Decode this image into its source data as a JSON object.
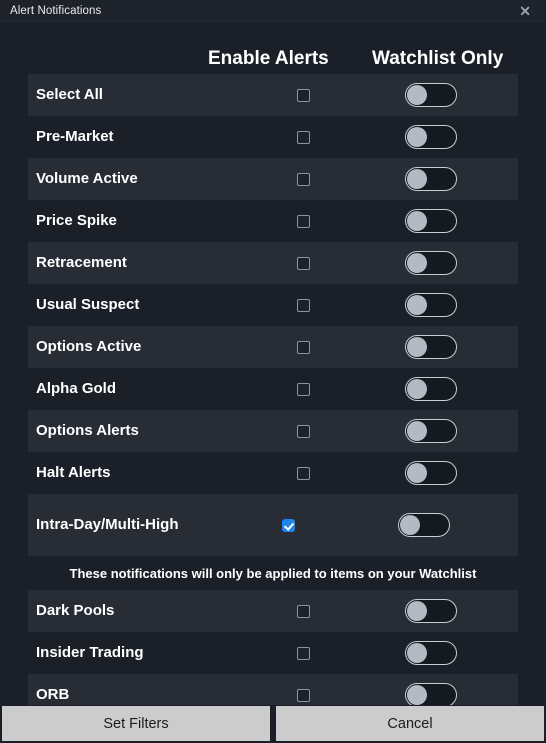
{
  "window": {
    "title": "Alert Notifications",
    "close_icon": "close-icon",
    "close_glyph": "✕"
  },
  "columns": {
    "label_col": "",
    "enable_alerts": "Enable Alerts",
    "watchlist_only": "Watchlist Only"
  },
  "colors": {
    "background": "#1b2028",
    "row_stripe": "#272c35",
    "titlebar": "#1e232b",
    "accent_checked": "#1e85f0",
    "toggle_knob": "#b3bac3",
    "toggle_track": "#151a21",
    "toggle_border": "#c8ced6",
    "footer_button": "#cccccc",
    "footer_button_text": "#1c1c1c",
    "text": "#ffffff"
  },
  "rows": [
    {
      "label": "Select All",
      "enabled": false,
      "watchlist_only": false,
      "striped": true
    },
    {
      "label": "Pre-Market",
      "enabled": false,
      "watchlist_only": false,
      "striped": false
    },
    {
      "label": "Volume Active",
      "enabled": false,
      "watchlist_only": false,
      "striped": true
    },
    {
      "label": "Price Spike",
      "enabled": false,
      "watchlist_only": false,
      "striped": false
    },
    {
      "label": "Retracement",
      "enabled": false,
      "watchlist_only": false,
      "striped": true
    },
    {
      "label": "Usual Suspect",
      "enabled": false,
      "watchlist_only": false,
      "striped": false
    },
    {
      "label": "Options Active",
      "enabled": false,
      "watchlist_only": false,
      "striped": true
    },
    {
      "label": "Alpha Gold",
      "enabled": false,
      "watchlist_only": false,
      "striped": false
    },
    {
      "label": "Options Alerts",
      "enabled": false,
      "watchlist_only": false,
      "striped": true
    },
    {
      "label": "Halt Alerts",
      "enabled": false,
      "watchlist_only": false,
      "striped": false
    },
    {
      "label": "Intra-Day/Multi-High",
      "enabled": true,
      "watchlist_only": false,
      "striped": true,
      "tall": true
    }
  ],
  "note": "These notifications will only be applied to items on your Watchlist",
  "watchlist_rows": [
    {
      "label": "Dark Pools",
      "enabled": false,
      "watchlist_only": false,
      "striped": true
    },
    {
      "label": "Insider Trading",
      "enabled": false,
      "watchlist_only": false,
      "striped": false
    },
    {
      "label": "ORB",
      "enabled": false,
      "watchlist_only": false,
      "striped": true
    }
  ],
  "footer": {
    "set_filters": "Set Filters",
    "cancel": "Cancel"
  }
}
